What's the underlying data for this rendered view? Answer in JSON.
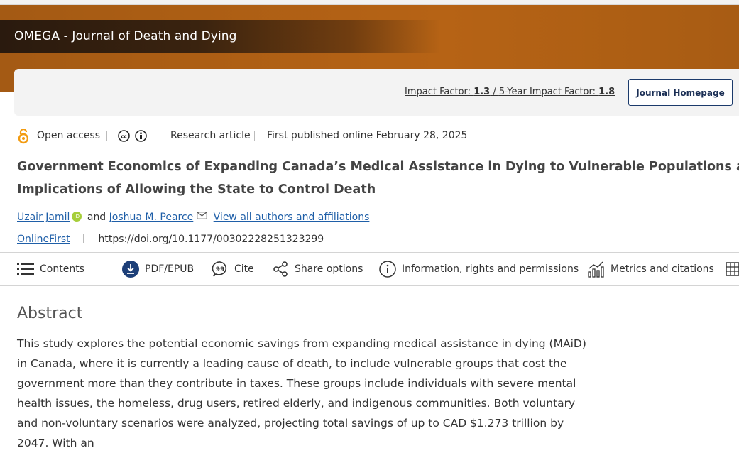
{
  "journal": {
    "title": "OMEGA - Journal of Death and Dying"
  },
  "metrics_bar": {
    "impact_factor_label": "Impact Factor:",
    "impact_factor_value": "1.3",
    "separator": "/",
    "five_year_label": "5-Year Impact Factor:",
    "five_year_value": "1.8",
    "homepage_button": "Journal Homepage"
  },
  "meta": {
    "access": "Open access",
    "article_type": "Research article",
    "published": "First published online February 28, 2025"
  },
  "article": {
    "title_line1": "Government Economics of Expanding Canada’s Medical Assistance in Dying to Vulnerable Populations and the Ethica",
    "title_line2": "Implications of Allowing the State to Control Death",
    "author1": "Uzair Jamil",
    "conjunction": "and",
    "author2": "Joshua M. Pearce",
    "view_all": "View all authors and affiliations",
    "online_first": "OnlineFirst",
    "doi": "https://doi.org/10.1177/00302228251323299"
  },
  "toolbar": {
    "contents": "Contents",
    "pdf": "PDF/EPUB",
    "cite": "Cite",
    "share": "Share options",
    "info": "Information, rights and permissions",
    "metrics": "Metrics and citations"
  },
  "abstract": {
    "heading": "Abstract",
    "text": "This study explores the potential economic savings from expanding medical assistance in dying (MAiD) in Canada, where it is currently a leading cause of death, to include vulnerable groups that cost the government more than they contribute in taxes. These groups include individuals with severe mental health issues, the homeless, drug users, retired elderly, and indigenous communities. Both voluntary and non-voluntary scenarios were analyzed, projecting total savings of up to CAD $1.273 trillion by 2047. With an"
  },
  "icons": [
    "open-access-lock-icon",
    "creative-commons-icon",
    "attribution-icon",
    "orcid-icon",
    "mail-icon",
    "contents-list-icon",
    "download-icon",
    "cite-quote-icon",
    "share-icon",
    "info-icon",
    "metrics-chart-icon",
    "table-icon"
  ],
  "colors": {
    "banner": "#b0601a",
    "link": "#1f5fa8",
    "button_border": "#1b3a6b",
    "orcid": "#a6ce39"
  }
}
